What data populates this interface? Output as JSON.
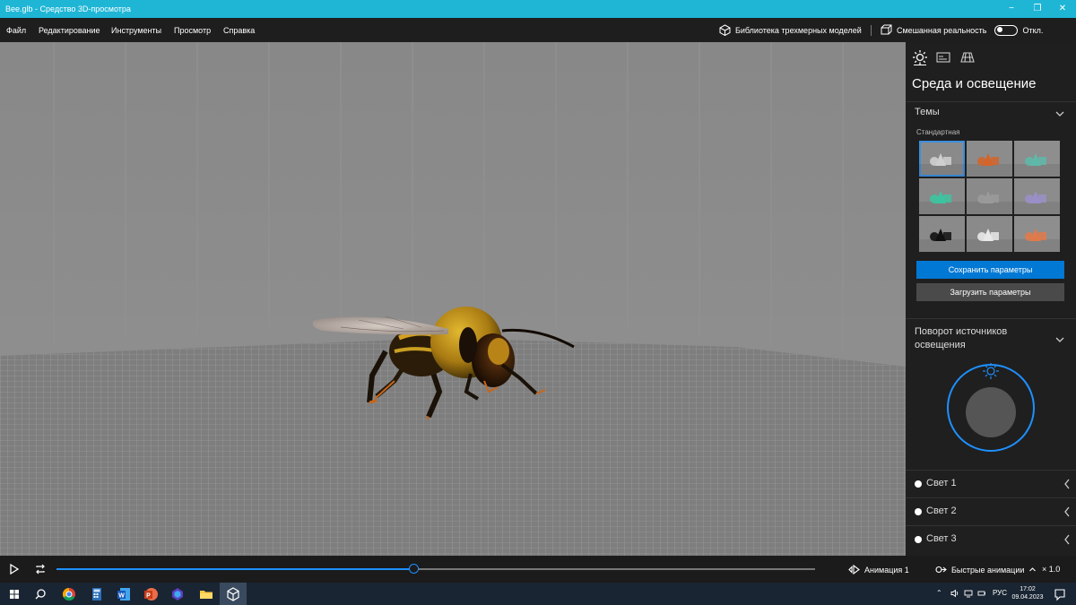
{
  "window": {
    "title": "Bee.glb - Средство 3D-просмотра",
    "minimize_label": "−",
    "restore_label": "❐",
    "close_label": "✕"
  },
  "menu": {
    "items": [
      "Файл",
      "Редактирование",
      "Инструменты",
      "Просмотр",
      "Справка"
    ],
    "library_label": "Библиотека трехмерных моделей",
    "mixed_reality_label": "Смешанная реальность",
    "toggle_state": "Откл."
  },
  "panel": {
    "tabs": [
      "sun-icon",
      "stats-icon",
      "grid-icon"
    ],
    "title": "Среда и освещение",
    "themes_section": "Темы",
    "standard_label": "Стандартная",
    "themes": [
      {
        "name": "standard",
        "selected": true,
        "accent": "#cfcfcf",
        "bg": "#8a8a8a"
      },
      {
        "name": "orange",
        "selected": false,
        "accent": "#d2652b",
        "bg": "#8c8c8c"
      },
      {
        "name": "teal",
        "selected": false,
        "accent": "#5fb8a8",
        "bg": "#8e8e8e"
      },
      {
        "name": "green",
        "selected": false,
        "accent": "#3cc4a0",
        "bg": "#8a8a8a"
      },
      {
        "name": "gray",
        "selected": false,
        "accent": "#9a9a9a",
        "bg": "#8a8a8a"
      },
      {
        "name": "lavender",
        "selected": false,
        "accent": "#9a8fc7",
        "bg": "#8c8c8c"
      },
      {
        "name": "dark",
        "selected": false,
        "accent": "#111111",
        "bg": "#8a8a8a"
      },
      {
        "name": "white",
        "selected": false,
        "accent": "#e8e8e8",
        "bg": "#8a8a8a"
      },
      {
        "name": "multicolor",
        "selected": false,
        "accent": "#e07a4a",
        "bg": "#8e8e8e"
      }
    ],
    "save_button": "Сохранить параметры",
    "load_button": "Загрузить параметры",
    "light_rotation_section": "Поворот источников освещения",
    "lights": [
      "Свет 1",
      "Свет 2",
      "Свет 3"
    ]
  },
  "animation": {
    "progress": 0.47,
    "animation_name": "Анимация 1",
    "quick_animations": "Быстрые анимации",
    "speed": "× 1.0"
  },
  "taskbar": {
    "apps": [
      "windows-start-icon",
      "search-icon",
      "chrome-icon",
      "calculator-icon",
      "word-icon",
      "powerpoint-icon",
      "azure-icon",
      "explorer-icon",
      "3d-viewer-icon"
    ],
    "active_app": "3d-viewer-icon",
    "language": "РУС",
    "time": "17:02",
    "date": "09.04.2023"
  },
  "colors": {
    "titlebar": "#1fb6d6",
    "accent": "#0078d4",
    "panel_bg": "#1f1f1f",
    "viewport_bg": "#8b8b8b"
  }
}
